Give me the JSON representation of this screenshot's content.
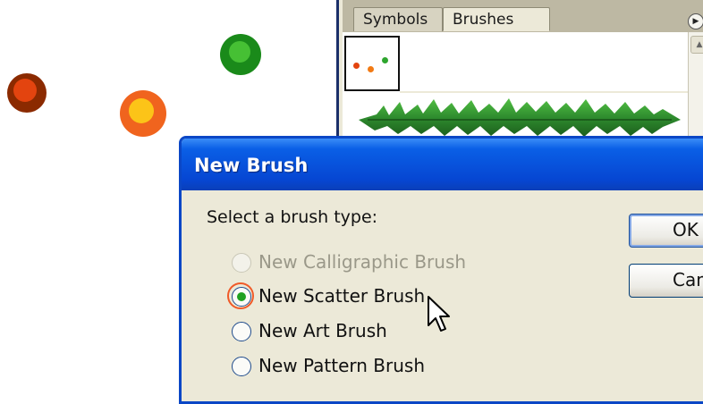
{
  "artboard": {
    "dots": [
      {
        "name": "red-dot",
        "outer": "#8b2a00",
        "inner": "#e3440f"
      },
      {
        "name": "orange-dot",
        "outer": "#f0641e",
        "inner": "#fcc418"
      },
      {
        "name": "green-dot",
        "outer": "#1a8a1a",
        "inner": "#46c034"
      }
    ]
  },
  "panel": {
    "tabs": [
      {
        "label": "Symbols"
      },
      {
        "label": "Brushes"
      }
    ],
    "menu_icon": "flyout-arrow-icon",
    "colors": {
      "accent": "#2e8b2e"
    }
  },
  "dialog": {
    "title": "New Brush",
    "prompt": "Select a brush type:",
    "options": [
      {
        "label": "New Calligraphic Brush",
        "enabled": false,
        "selected": false
      },
      {
        "label": "New Scatter Brush",
        "enabled": true,
        "selected": true
      },
      {
        "label": "New Art Brush",
        "enabled": true,
        "selected": false
      },
      {
        "label": "New Pattern Brush",
        "enabled": true,
        "selected": false
      }
    ],
    "buttons": {
      "ok": "OK",
      "cancel": "Cancel"
    }
  }
}
